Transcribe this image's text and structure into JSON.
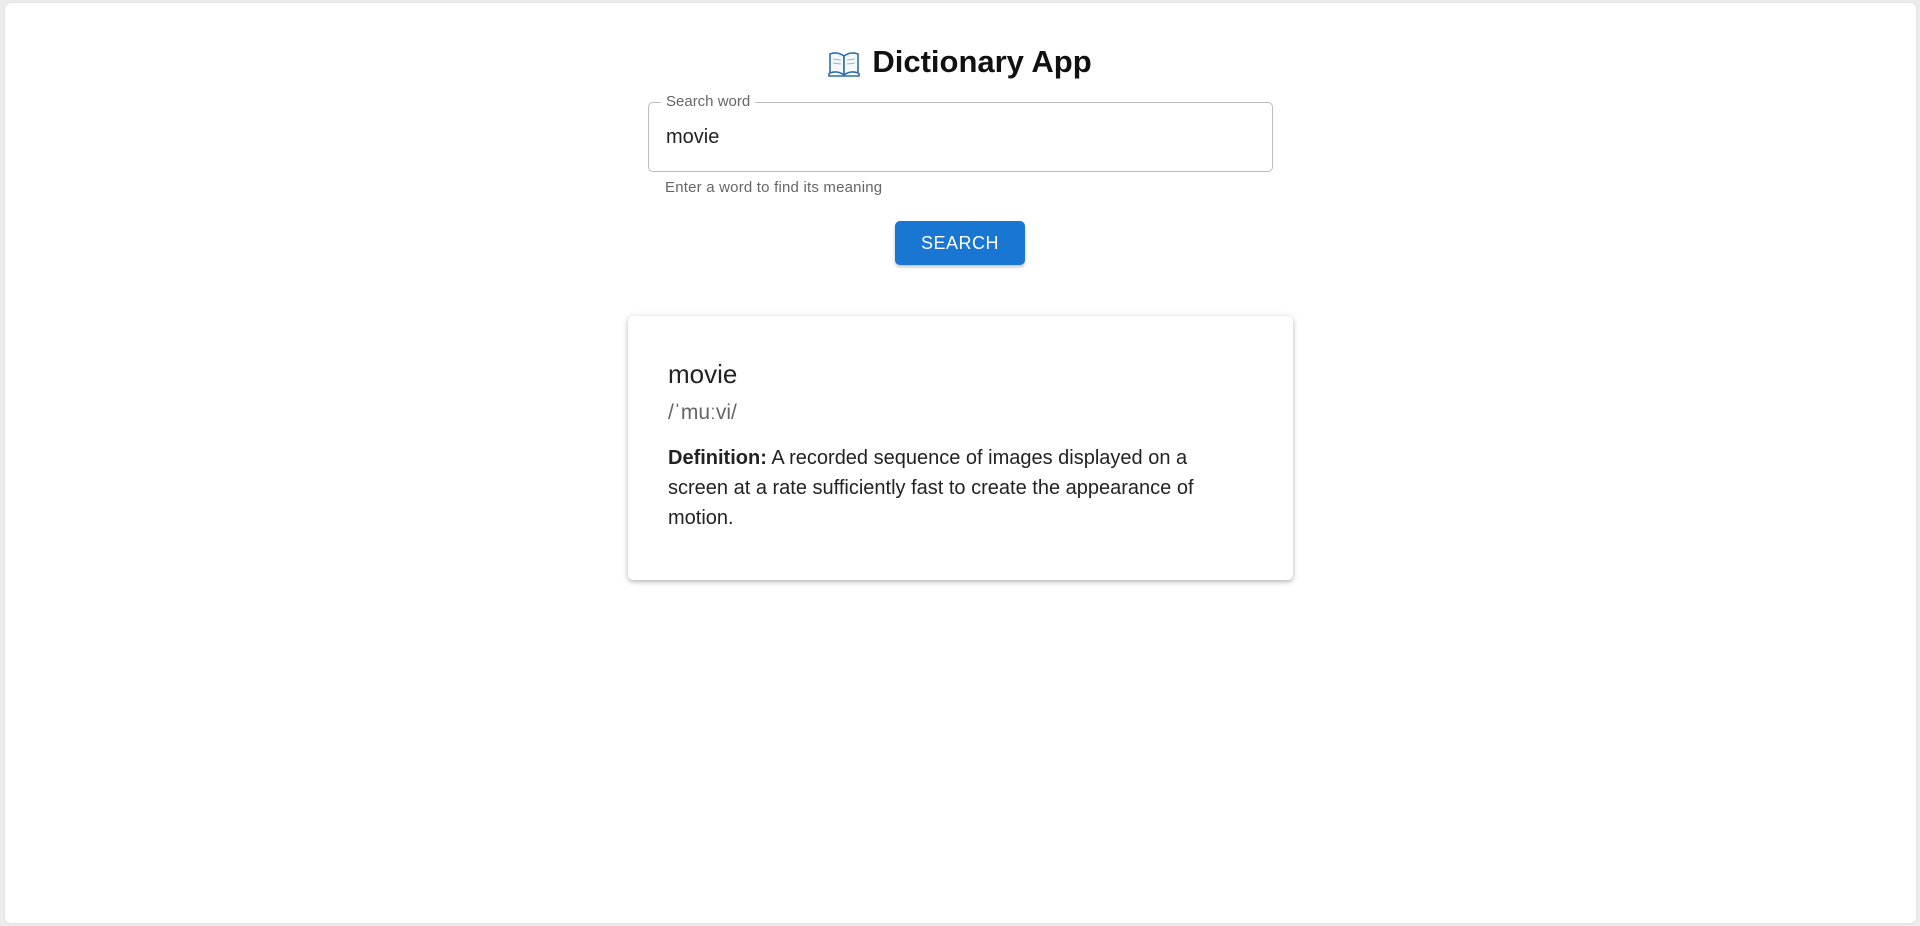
{
  "app": {
    "title": "Dictionary App",
    "title_icon": "open-book-icon"
  },
  "search": {
    "label": "Search word",
    "value": "movie",
    "helper": "Enter a word to find its meaning",
    "button_label": "SEARCH"
  },
  "result": {
    "word": "movie",
    "phonetic": "/ˈmuːvi/",
    "definition_label": "Definition:",
    "definition_text": " A recorded sequence of images displayed on a screen at a rate sufficiently fast to create the appearance of motion."
  },
  "colors": {
    "accent": "#1976d2",
    "background": "#ffffff",
    "text": "#222222",
    "muted": "#666666"
  }
}
